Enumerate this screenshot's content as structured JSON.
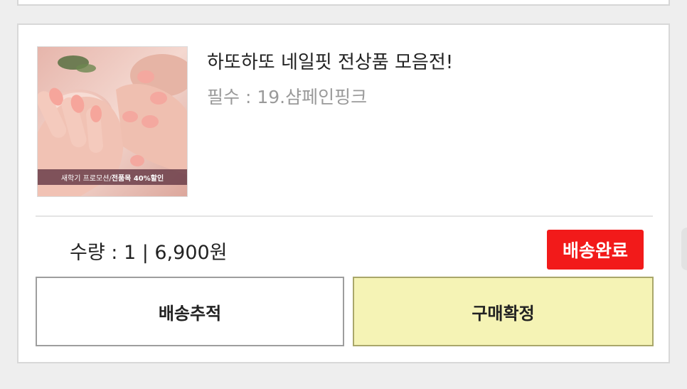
{
  "order": {
    "product_title": "하또하또 네일핏 전상품 모음전!",
    "product_option": "필수 : 19.샴페인핑크",
    "thumbnail_caption_prefix": "새학기 프로모션/ ",
    "thumbnail_caption_highlight": "전품목 40%할인",
    "quantity_price": "수량 : 1 | 6,900원",
    "status_badge": "배송완료",
    "track_button": "배송추적",
    "confirm_button": "구매확정"
  },
  "colors": {
    "status_red": "#f21a1a",
    "confirm_yellow": "#f5f3b5",
    "background": "#eeeeee"
  }
}
